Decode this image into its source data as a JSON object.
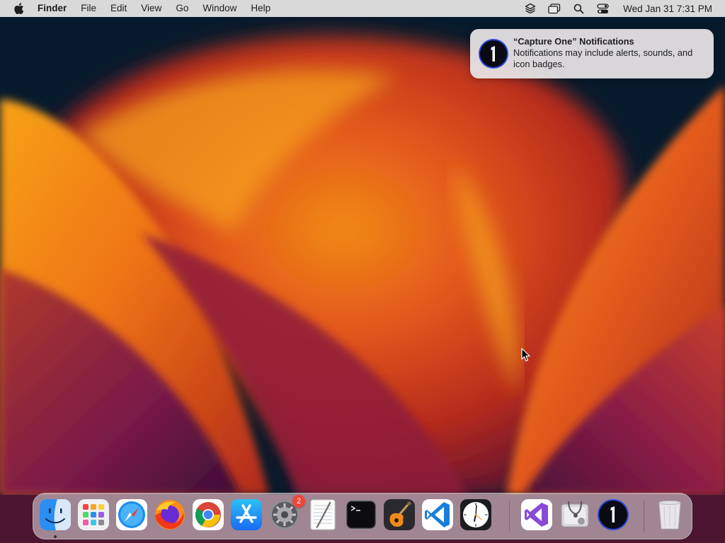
{
  "menubar": {
    "apple_icon": "apple-logo-icon",
    "app_name": "Finder",
    "menus": [
      "File",
      "Edit",
      "View",
      "Go",
      "Window",
      "Help"
    ],
    "status_icons": [
      "layers-icon",
      "windows-icon",
      "search-icon",
      "control-center-icon"
    ],
    "clock": "Wed Jan 31  7:31 PM"
  },
  "notification": {
    "app_icon": "capture-one-icon",
    "title": "“Capture One” Notifications",
    "body": "Notifications may include alerts, sounds, and icon badges."
  },
  "dock": {
    "items": [
      {
        "name": "Finder",
        "icon": "finder-icon",
        "running": true
      },
      {
        "name": "Launchpad",
        "icon": "launchpad-icon"
      },
      {
        "name": "Safari",
        "icon": "safari-icon"
      },
      {
        "name": "Firefox",
        "icon": "firefox-icon"
      },
      {
        "name": "Google Chrome",
        "icon": "chrome-icon"
      },
      {
        "name": "App Store",
        "icon": "app-store-icon"
      },
      {
        "name": "System Settings",
        "icon": "system-settings-icon",
        "badge": "2"
      },
      {
        "name": "TextEdit",
        "icon": "textedit-icon"
      },
      {
        "name": "Terminal",
        "icon": "terminal-icon"
      },
      {
        "name": "GarageBand",
        "icon": "garageband-icon"
      },
      {
        "name": "Visual Studio Code",
        "icon": "vscode-icon"
      },
      {
        "name": "Clock",
        "icon": "clock-icon"
      },
      {
        "name": "Visual Studio",
        "icon": "visual-studio-icon"
      },
      {
        "name": "Disk Utility",
        "icon": "disk-utility-icon"
      },
      {
        "name": "Capture One",
        "icon": "capture-one-icon"
      },
      {
        "name": "Trash",
        "icon": "trash-icon"
      }
    ]
  },
  "colors": {
    "wallpaper_base": "#071a2c",
    "wallpaper_orange": "#f07a12",
    "wallpaper_red": "#c8321a",
    "wallpaper_purple": "#7a1a4a",
    "badge": "#f0453a"
  }
}
